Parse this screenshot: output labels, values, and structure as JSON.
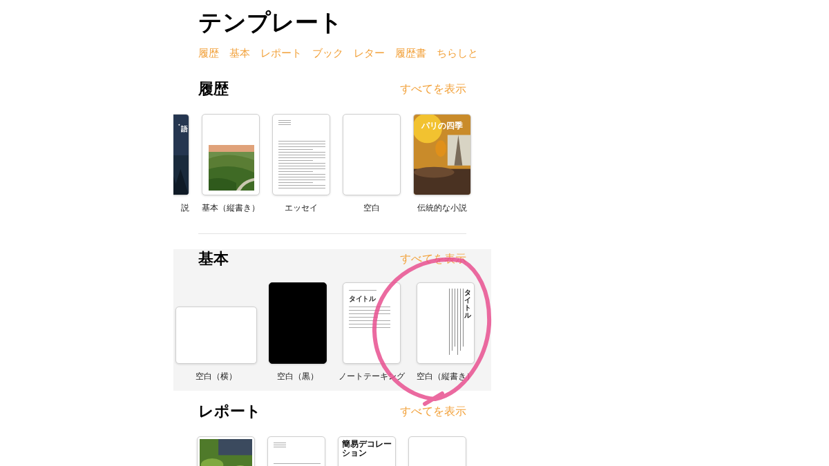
{
  "title": "テンプレート",
  "categories": [
    "履歴",
    "基本",
    "レポート",
    "ブック",
    "レター",
    "履歴書",
    "ちらしと"
  ],
  "sections": [
    {
      "heading": "履歴",
      "see_all": "すべてを表示",
      "scrolled": true,
      "shaded": false,
      "templates": [
        {
          "kind": "starry",
          "cover_title": "語",
          "name": "説"
        },
        {
          "kind": "photo-vertical",
          "name": "基本（縦書き）"
        },
        {
          "kind": "essay",
          "name": "エッセイ"
        },
        {
          "kind": "blank",
          "name": "空白"
        },
        {
          "kind": "novel",
          "cover_title": "パリの四季",
          "name": "伝統的な小説"
        }
      ]
    },
    {
      "heading": "基本",
      "see_all": "すべてを表示",
      "scrolled": false,
      "shaded": true,
      "templates": [
        {
          "kind": "blank-landscape",
          "name": "空白（横）"
        },
        {
          "kind": "black",
          "name": "空白（黒）"
        },
        {
          "kind": "notes",
          "cover_title": "タイトル",
          "name": "ノートテーキング"
        },
        {
          "kind": "vertical",
          "cover_title": "タイトル",
          "name": "空白（縦書き）"
        }
      ]
    },
    {
      "heading": "レポート",
      "see_all": "すべてを表示",
      "scrolled": false,
      "shaded": false,
      "templates": [
        {
          "kind": "tea-photo"
        },
        {
          "kind": "essay"
        },
        {
          "kind": "decor",
          "cover_title": "簡易デコレーション"
        },
        {
          "kind": "blank"
        }
      ]
    }
  ],
  "annotation": {
    "kind": "circle"
  }
}
